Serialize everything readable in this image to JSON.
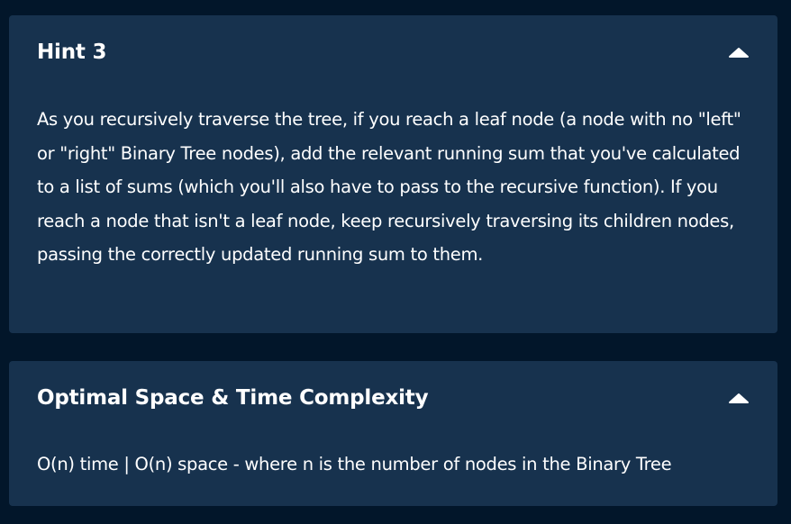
{
  "hint": {
    "title": "Hint 3",
    "toggle_icon": "caret-up-icon",
    "body": "As you recursively traverse the tree, if you reach a leaf node (a node with no \"left\" or \"right\" Binary Tree nodes), add the relevant running sum that you've calculated to a list of sums (which you'll also have to pass to the recursive function). If you reach a node that isn't a leaf node, keep recursively traversing its children nodes, passing the correctly updated running sum to them."
  },
  "complexity": {
    "title": "Optimal Space & Time Complexity",
    "toggle_icon": "caret-up-icon",
    "body": "O(n) time | O(n) space - where n is the number of nodes in the Binary Tree"
  },
  "colors": {
    "background": "#02162a",
    "panel": "#17324e",
    "text": "#ffffff"
  }
}
